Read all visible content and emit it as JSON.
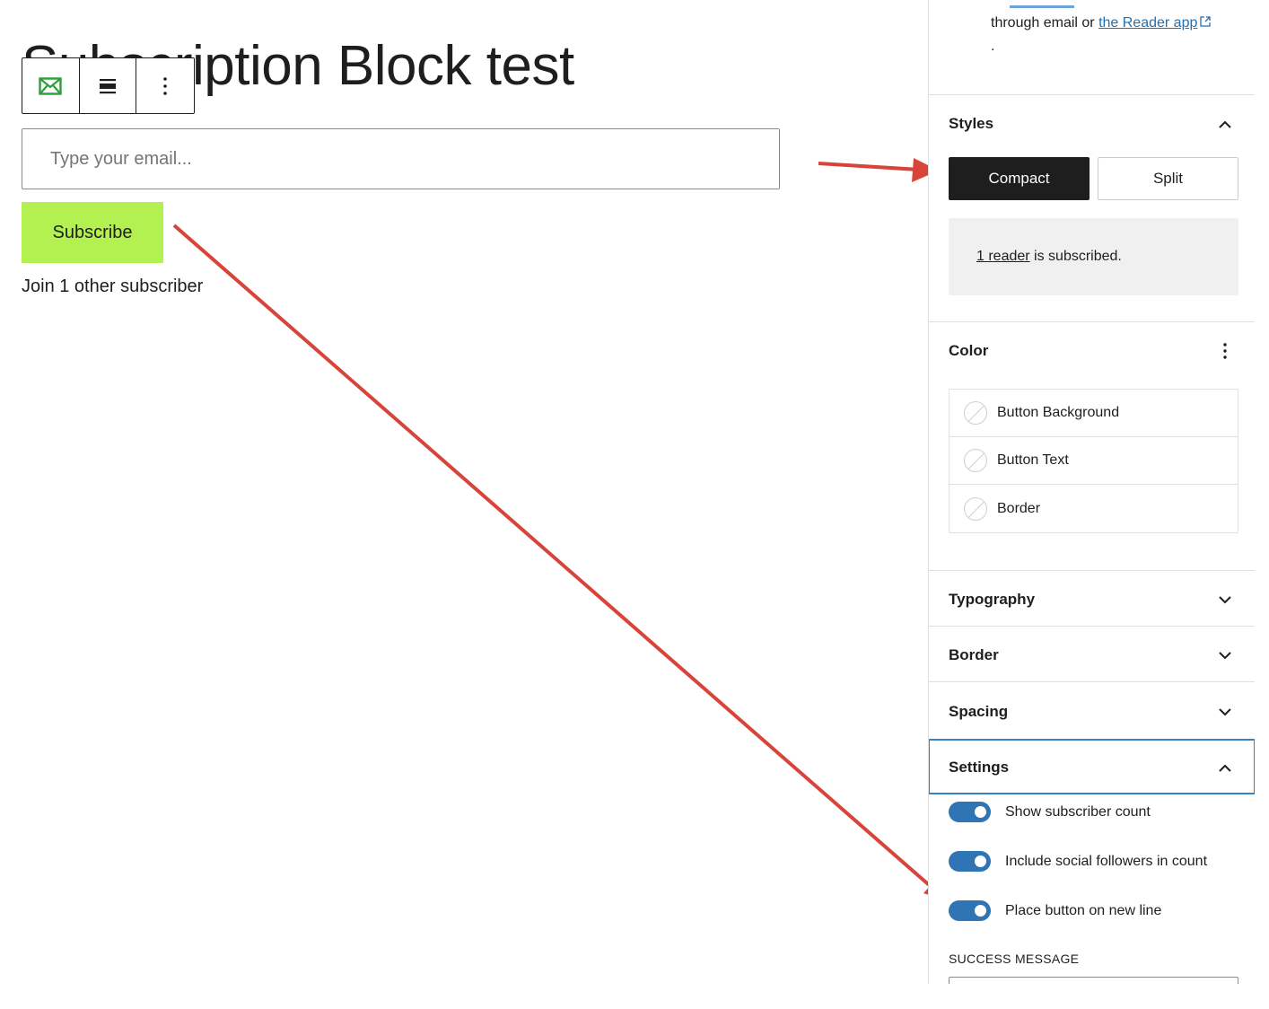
{
  "editor": {
    "page_title": "Subscription Block test",
    "toolbar": {
      "block_icon": "envelope-icon",
      "align_icon": "align-icon",
      "options_icon": "more-vertical-icon"
    },
    "email_placeholder": "Type your email...",
    "subscribe_label": "Subscribe",
    "subscriber_text": "Join 1 other subscriber",
    "accent_button_color": "#b2f14f"
  },
  "sidebar": {
    "intro_text": "through email or ",
    "intro_link": "the Reader app",
    "intro_suffix": ".",
    "styles": {
      "title": "Styles",
      "compact_label": "Compact",
      "split_label": "Split",
      "selected": "Compact",
      "reader_count_link": "1 reader",
      "reader_count_text": " is subscribed."
    },
    "color": {
      "title": "Color",
      "items": [
        {
          "label": "Button Background"
        },
        {
          "label": "Button Text"
        },
        {
          "label": "Border"
        }
      ]
    },
    "panels": {
      "typography": "Typography",
      "border": "Border",
      "spacing": "Spacing",
      "settings": "Settings"
    },
    "settings": {
      "toggles": [
        {
          "label": "Show subscriber count",
          "on": true
        },
        {
          "label": "Include social followers in count",
          "on": true
        },
        {
          "label": "Place button on new line",
          "on": true
        }
      ],
      "success_message_label": "Success message"
    },
    "accent_color": "#2f74b5"
  },
  "annotation_color": "#d9443a"
}
